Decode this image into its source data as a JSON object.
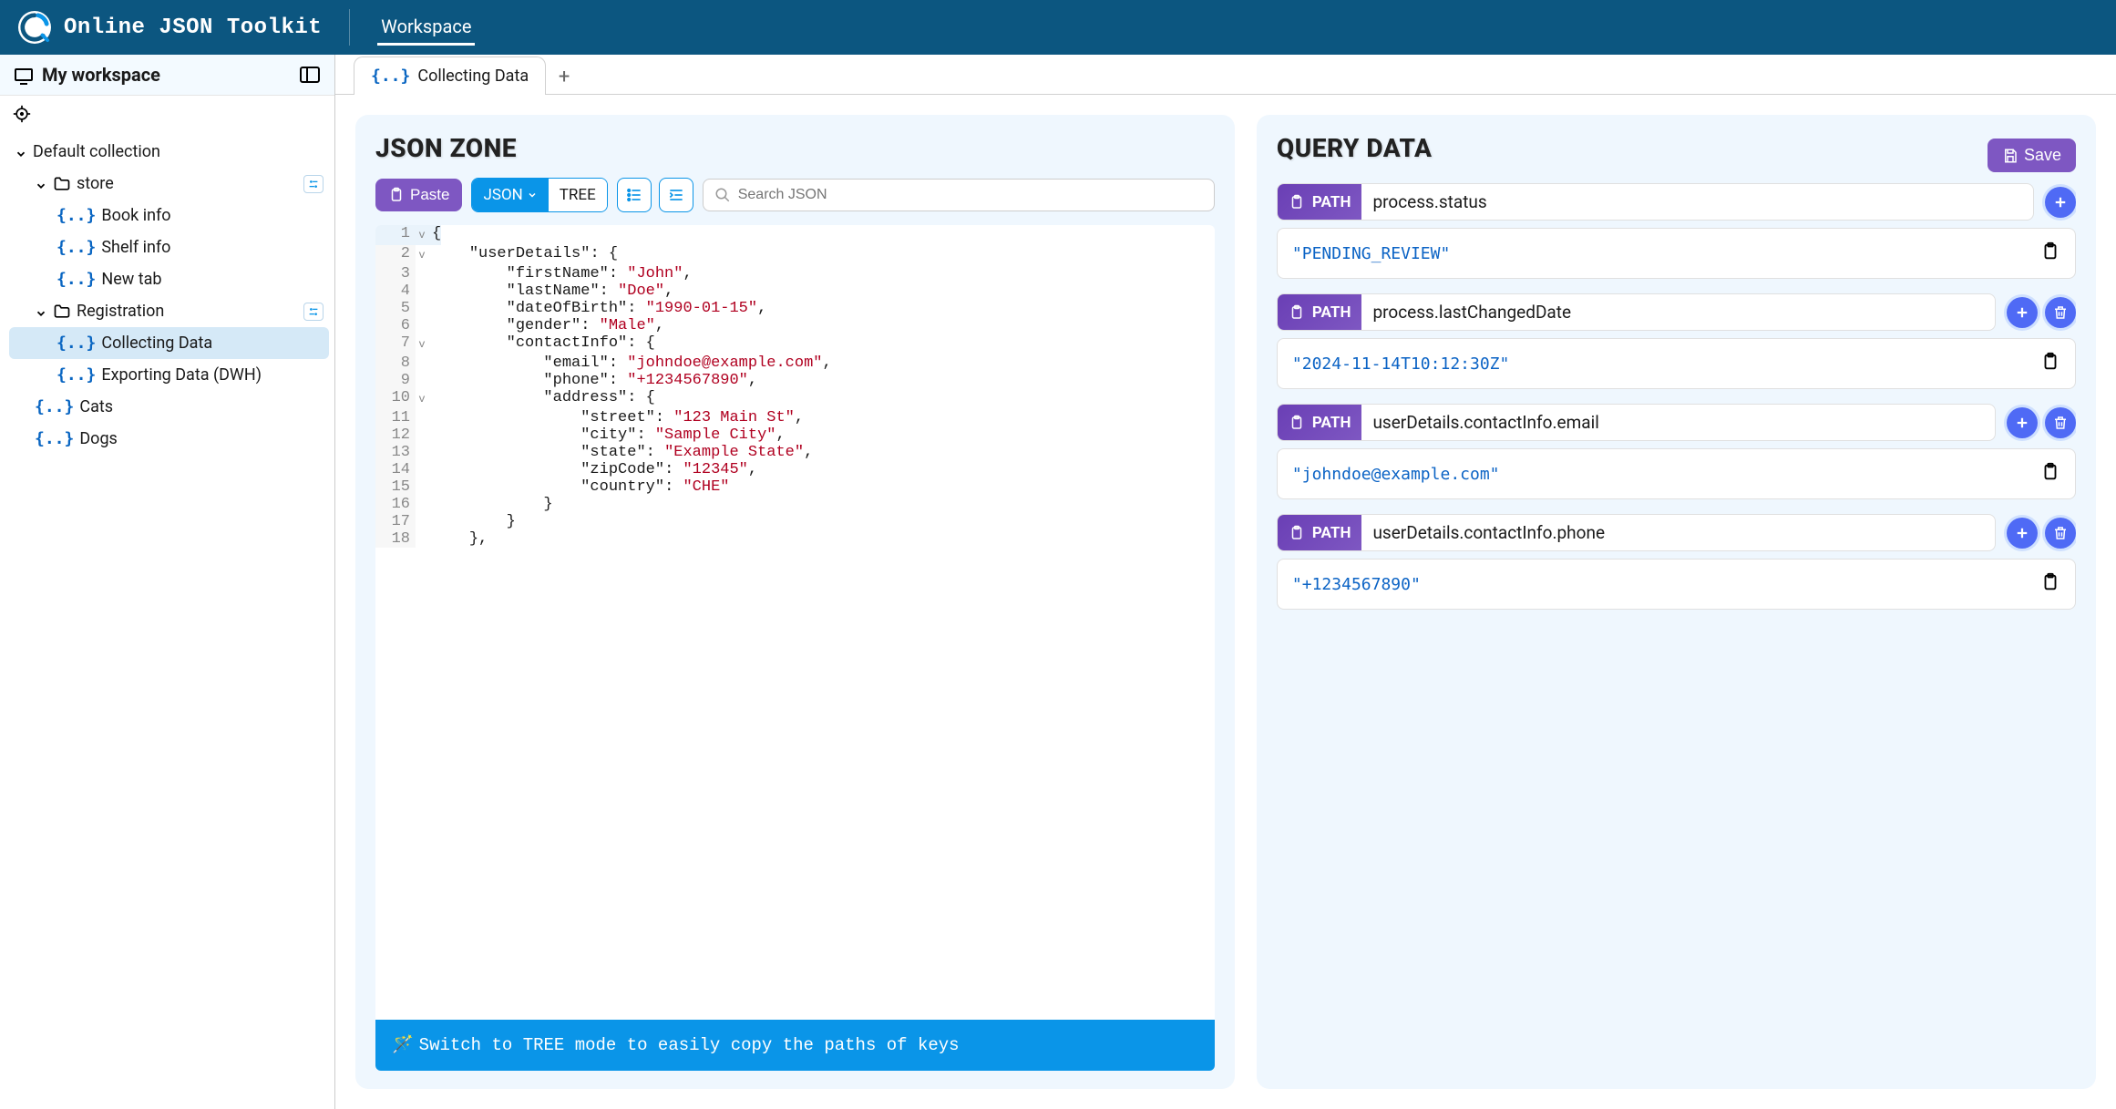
{
  "app": {
    "title": "Online JSON Toolkit",
    "headerTab": "Workspace"
  },
  "sidebar": {
    "title": "My workspace",
    "collection": "Default collection",
    "nodes": {
      "store": "store",
      "bookInfo": "Book info",
      "shelfInfo": "Shelf info",
      "newTab": "New tab",
      "registration": "Registration",
      "collecting": "Collecting Data",
      "exporting": "Exporting Data (DWH)",
      "cats": "Cats",
      "dogs": "Dogs"
    }
  },
  "tabs": {
    "active": "Collecting Data"
  },
  "jsonZone": {
    "title": "JSON ZONE",
    "pasteLabel": "Paste",
    "modeJson": "JSON",
    "modeTree": "TREE",
    "searchPlaceholder": "Search JSON",
    "hint": "Switch to TREE mode to easily copy the paths of keys",
    "code": [
      {
        "n": 1,
        "fold": "v",
        "hl": true,
        "indent": 0,
        "seg": [
          [
            "punc",
            "{"
          ]
        ]
      },
      {
        "n": 2,
        "fold": "v",
        "indent": 1,
        "seg": [
          [
            "key",
            "\"userDetails\""
          ],
          [
            "punc",
            ": {"
          ]
        ]
      },
      {
        "n": 3,
        "indent": 2,
        "seg": [
          [
            "key",
            "\"firstName\""
          ],
          [
            "punc",
            ": "
          ],
          [
            "str",
            "\"John\""
          ],
          [
            "punc",
            ","
          ]
        ]
      },
      {
        "n": 4,
        "indent": 2,
        "seg": [
          [
            "key",
            "\"lastName\""
          ],
          [
            "punc",
            ": "
          ],
          [
            "str",
            "\"Doe\""
          ],
          [
            "punc",
            ","
          ]
        ]
      },
      {
        "n": 5,
        "indent": 2,
        "seg": [
          [
            "key",
            "\"dateOfBirth\""
          ],
          [
            "punc",
            ": "
          ],
          [
            "str",
            "\"1990-01-15\""
          ],
          [
            "punc",
            ","
          ]
        ]
      },
      {
        "n": 6,
        "indent": 2,
        "seg": [
          [
            "key",
            "\"gender\""
          ],
          [
            "punc",
            ": "
          ],
          [
            "str",
            "\"Male\""
          ],
          [
            "punc",
            ","
          ]
        ]
      },
      {
        "n": 7,
        "fold": "v",
        "indent": 2,
        "seg": [
          [
            "key",
            "\"contactInfo\""
          ],
          [
            "punc",
            ": {"
          ]
        ]
      },
      {
        "n": 8,
        "indent": 3,
        "seg": [
          [
            "key",
            "\"email\""
          ],
          [
            "punc",
            ": "
          ],
          [
            "str",
            "\"johndoe@example.com\""
          ],
          [
            "punc",
            ","
          ]
        ]
      },
      {
        "n": 9,
        "indent": 3,
        "seg": [
          [
            "key",
            "\"phone\""
          ],
          [
            "punc",
            ": "
          ],
          [
            "str",
            "\"+1234567890\""
          ],
          [
            "punc",
            ","
          ]
        ]
      },
      {
        "n": 10,
        "fold": "v",
        "indent": 3,
        "seg": [
          [
            "key",
            "\"address\""
          ],
          [
            "punc",
            ": {"
          ]
        ]
      },
      {
        "n": 11,
        "indent": 4,
        "seg": [
          [
            "key",
            "\"street\""
          ],
          [
            "punc",
            ": "
          ],
          [
            "str",
            "\"123 Main St\""
          ],
          [
            "punc",
            ","
          ]
        ]
      },
      {
        "n": 12,
        "indent": 4,
        "seg": [
          [
            "key",
            "\"city\""
          ],
          [
            "punc",
            ": "
          ],
          [
            "str",
            "\"Sample City\""
          ],
          [
            "punc",
            ","
          ]
        ]
      },
      {
        "n": 13,
        "indent": 4,
        "seg": [
          [
            "key",
            "\"state\""
          ],
          [
            "punc",
            ": "
          ],
          [
            "str",
            "\"Example State\""
          ],
          [
            "punc",
            ","
          ]
        ]
      },
      {
        "n": 14,
        "indent": 4,
        "seg": [
          [
            "key",
            "\"zipCode\""
          ],
          [
            "punc",
            ": "
          ],
          [
            "str",
            "\"12345\""
          ],
          [
            "punc",
            ","
          ]
        ]
      },
      {
        "n": 15,
        "indent": 4,
        "seg": [
          [
            "key",
            "\"country\""
          ],
          [
            "punc",
            ": "
          ],
          [
            "str",
            "\"CHE\""
          ]
        ]
      },
      {
        "n": 16,
        "indent": 3,
        "seg": [
          [
            "punc",
            "}"
          ]
        ]
      },
      {
        "n": 17,
        "indent": 2,
        "seg": [
          [
            "punc",
            "}"
          ]
        ]
      },
      {
        "n": 18,
        "indent": 1,
        "seg": [
          [
            "punc",
            "},"
          ]
        ]
      }
    ]
  },
  "queryData": {
    "title": "QUERY DATA",
    "saveLabel": "Save",
    "pathBadge": "PATH",
    "items": [
      {
        "path": "process.status",
        "result": "\"PENDING_REVIEW\"",
        "deletable": false
      },
      {
        "path": "process.lastChangedDate",
        "result": "\"2024-11-14T10:12:30Z\"",
        "deletable": true
      },
      {
        "path": "userDetails.contactInfo.email",
        "result": "\"johndoe@example.com\"",
        "deletable": true
      },
      {
        "path": "userDetails.contactInfo.phone",
        "result": "\"+1234567890\"",
        "deletable": true
      }
    ]
  }
}
